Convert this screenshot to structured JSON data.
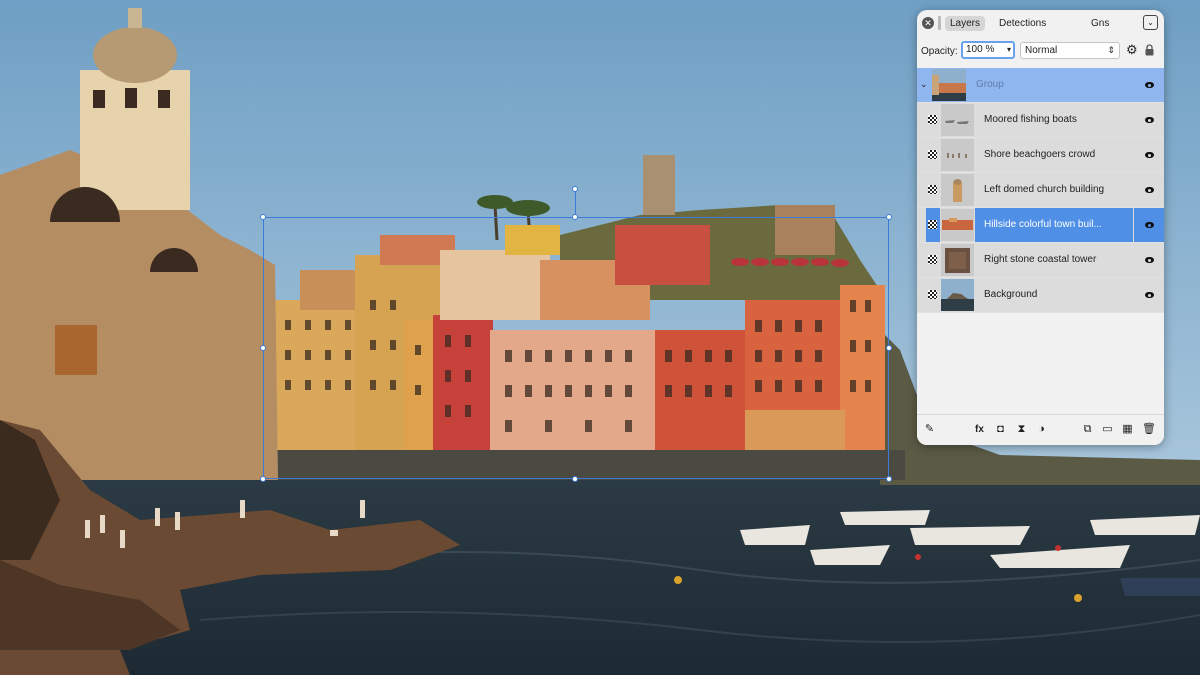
{
  "panel": {
    "tabs": [
      "Layers",
      "Detections",
      "Gns"
    ],
    "opacity_label": "Opacity:",
    "opacity_value": "100 %",
    "blend_mode": "Normal",
    "layers": [
      {
        "name": "Group",
        "type": "group",
        "expanded": true
      },
      {
        "name": "Moored fishing boats",
        "selected": false
      },
      {
        "name": "Shore beachgoers crowd",
        "selected": false
      },
      {
        "name": "Left domed church building",
        "selected": false
      },
      {
        "name": "Hillside colorful town buil...",
        "selected": true
      },
      {
        "name": "Right stone coastal tower",
        "selected": false
      },
      {
        "name": "Background",
        "selected": false
      }
    ],
    "footer_icons": [
      "edit-icon",
      "fx-icon",
      "mask-icon",
      "adjustment-icon",
      "contrast-icon",
      "add-layer-icon",
      "folder-icon",
      "checker-icon",
      "trash-icon"
    ]
  },
  "colors": {
    "accent": "#4f8fe6",
    "group_row": "#8fb6ee",
    "selection_box": "#3d7bd9"
  }
}
